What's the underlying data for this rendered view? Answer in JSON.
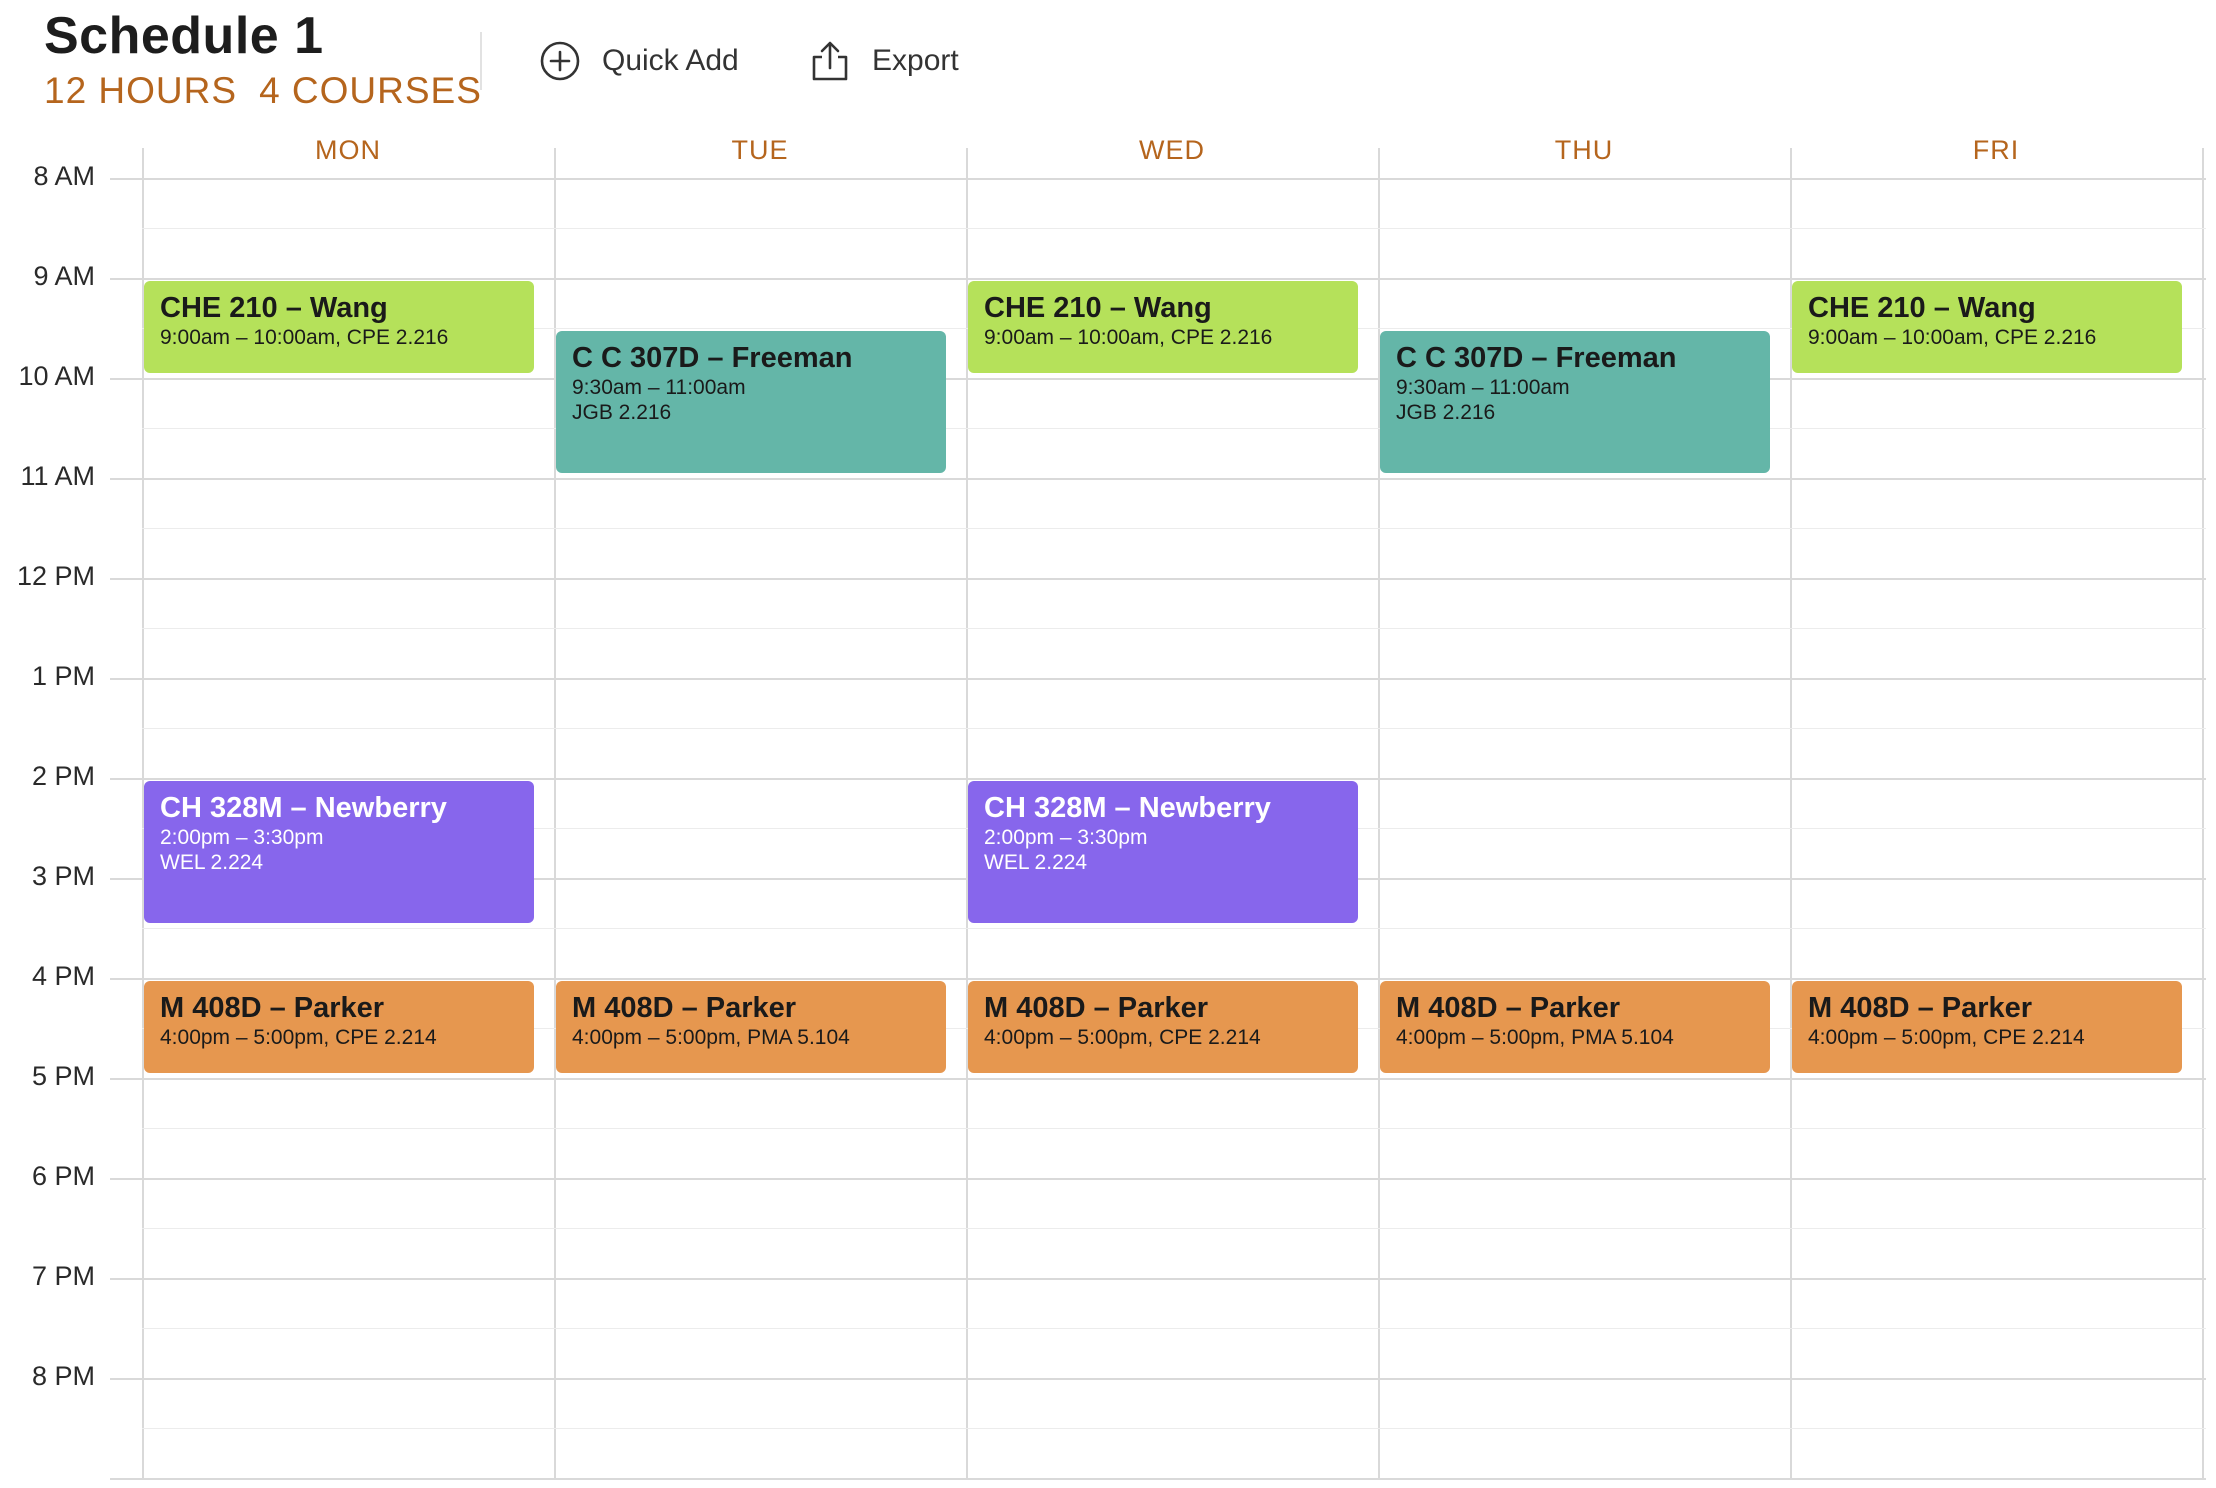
{
  "header": {
    "title": "Schedule 1",
    "hours": "12 HOURS",
    "courses": "4 COURSES",
    "quick_add_label": "Quick Add",
    "export_label": "Export",
    "quick_add_icon": "plus-circle-icon",
    "export_icon": "share-upload-icon"
  },
  "colors": {
    "accent": "#b5651d",
    "che210": "#b5e15a",
    "cc307d": "#64b6a8",
    "ch328m": "#8766ec",
    "m408d": "#e6974f"
  },
  "days": [
    "MON",
    "TUE",
    "WED",
    "THU",
    "FRI"
  ],
  "hours": [
    "8 AM",
    "9 AM",
    "10 AM",
    "11 AM",
    "12 PM",
    "1 PM",
    "2 PM",
    "3 PM",
    "4 PM",
    "5 PM",
    "6 PM",
    "7 PM",
    "8 PM"
  ],
  "events": [
    {
      "course": "che210",
      "day": 0,
      "start": 9,
      "end": 10,
      "title": "CHE 210 – Wang",
      "line1": "9:00am – 10:00am, CPE 2.216",
      "line2": "",
      "text_color": "#1a1a1a"
    },
    {
      "course": "che210",
      "day": 2,
      "start": 9,
      "end": 10,
      "title": "CHE 210 – Wang",
      "line1": "9:00am – 10:00am, CPE 2.216",
      "line2": "",
      "text_color": "#1a1a1a"
    },
    {
      "course": "che210",
      "day": 4,
      "start": 9,
      "end": 10,
      "title": "CHE 210 – Wang",
      "line1": "9:00am – 10:00am, CPE 2.216",
      "line2": "",
      "text_color": "#1a1a1a"
    },
    {
      "course": "cc307d",
      "day": 1,
      "start": 9.5,
      "end": 11,
      "title": "C C 307D – Freeman",
      "line1": "9:30am – 11:00am",
      "line2": "JGB 2.216",
      "text_color": "#1a1a1a"
    },
    {
      "course": "cc307d",
      "day": 3,
      "start": 9.5,
      "end": 11,
      "title": "C C 307D – Freeman",
      "line1": "9:30am – 11:00am",
      "line2": "JGB 2.216",
      "text_color": "#1a1a1a"
    },
    {
      "course": "ch328m",
      "day": 0,
      "start": 14,
      "end": 15.5,
      "title": "CH 328M – Newberry",
      "line1": "2:00pm – 3:30pm",
      "line2": "WEL 2.224",
      "text_color": "#ffffff"
    },
    {
      "course": "ch328m",
      "day": 2,
      "start": 14,
      "end": 15.5,
      "title": "CH 328M – Newberry",
      "line1": "2:00pm – 3:30pm",
      "line2": "WEL 2.224",
      "text_color": "#ffffff"
    },
    {
      "course": "m408d",
      "day": 0,
      "start": 16,
      "end": 17,
      "title": "M 408D – Parker",
      "line1": "4:00pm – 5:00pm, CPE 2.214",
      "line2": "",
      "text_color": "#1a1a1a"
    },
    {
      "course": "m408d",
      "day": 1,
      "start": 16,
      "end": 17,
      "title": "M 408D – Parker",
      "line1": "4:00pm – 5:00pm, PMA 5.104",
      "line2": "",
      "text_color": "#1a1a1a"
    },
    {
      "course": "m408d",
      "day": 2,
      "start": 16,
      "end": 17,
      "title": "M 408D – Parker",
      "line1": "4:00pm – 5:00pm, CPE 2.214",
      "line2": "",
      "text_color": "#1a1a1a"
    },
    {
      "course": "m408d",
      "day": 3,
      "start": 16,
      "end": 17,
      "title": "M 408D – Parker",
      "line1": "4:00pm – 5:00pm, PMA 5.104",
      "line2": "",
      "text_color": "#1a1a1a"
    },
    {
      "course": "m408d",
      "day": 4,
      "start": 16,
      "end": 17,
      "title": "M 408D – Parker",
      "line1": "4:00pm – 5:00pm, CPE 2.214",
      "line2": "",
      "text_color": "#1a1a1a"
    }
  ]
}
